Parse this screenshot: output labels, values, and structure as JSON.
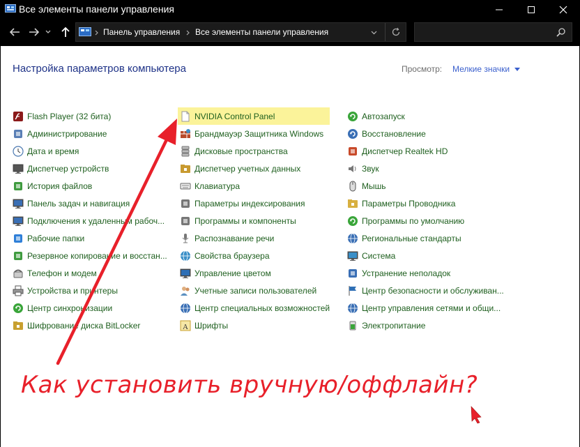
{
  "window": {
    "title": "Все элементы панели управления",
    "controls": {
      "minimize": "—",
      "maximize": "☐",
      "close": "✕"
    }
  },
  "toolbar": {
    "back_icon": "arrow-left-icon",
    "forward_icon": "arrow-right-icon",
    "up_icon": "arrow-up-icon",
    "breadcrumb": [
      "Панель управления",
      "Все элементы панели управления"
    ],
    "refresh_icon": "refresh-icon",
    "search_placeholder": ""
  },
  "main": {
    "heading": "Настройка параметров компьютера",
    "view_label": "Просмотр:",
    "view_value": "Мелкие значки"
  },
  "columns": [
    [
      {
        "label": "Flash Player (32 бита)",
        "icon": "flash-icon",
        "color": "#8b1a1a"
      },
      {
        "label": "Администрирование",
        "icon": "admin-tools-icon",
        "color": "#5a7fb5"
      },
      {
        "label": "Дата и время",
        "icon": "clock-icon",
        "color": "#4a78b0"
      },
      {
        "label": "Диспетчер устройств",
        "icon": "device-manager-icon",
        "color": "#555"
      },
      {
        "label": "История файлов",
        "icon": "file-history-icon",
        "color": "#3f9b3f"
      },
      {
        "label": "Панель задач и навигация",
        "icon": "taskbar-icon",
        "color": "#3a6fb5"
      },
      {
        "label": "Подключения к удаленным рабоч...",
        "icon": "remote-desktop-icon",
        "color": "#3a6fb5"
      },
      {
        "label": "Рабочие папки",
        "icon": "work-folders-icon",
        "color": "#2f7fd8"
      },
      {
        "label": "Резервное копирование и восстан...",
        "icon": "backup-icon",
        "color": "#3f9b3f"
      },
      {
        "label": "Телефон и модем",
        "icon": "phone-icon",
        "color": "#666"
      },
      {
        "label": "Устройства и принтеры",
        "icon": "printer-icon",
        "color": "#555"
      },
      {
        "label": "Центр синхронизации",
        "icon": "sync-icon",
        "color": "#3aa53a"
      },
      {
        "label": "Шифрование диска BitLocker",
        "icon": "bitlocker-icon",
        "color": "#c8a030"
      }
    ],
    [
      {
        "label": "NVIDIA Control Panel",
        "icon": "document-icon",
        "color": "#999",
        "highlight": true
      },
      {
        "label": "Брандмауэр Защитника Windows",
        "icon": "firewall-icon",
        "color": "#b84a2a"
      },
      {
        "label": "Дисковые пространства",
        "icon": "storage-spaces-icon",
        "color": "#777"
      },
      {
        "label": "Диспетчер учетных данных",
        "icon": "credential-manager-icon",
        "color": "#c89a30"
      },
      {
        "label": "Клавиатура",
        "icon": "keyboard-icon",
        "color": "#666"
      },
      {
        "label": "Параметры индексирования",
        "icon": "indexing-icon",
        "color": "#777"
      },
      {
        "label": "Программы и компоненты",
        "icon": "programs-icon",
        "color": "#777"
      },
      {
        "label": "Распознавание речи",
        "icon": "microphone-icon",
        "color": "#777"
      },
      {
        "label": "Свойства браузера",
        "icon": "internet-options-icon",
        "color": "#3a8fc8"
      },
      {
        "label": "Управление цветом",
        "icon": "color-management-icon",
        "color": "#2f6fb5"
      },
      {
        "label": "Учетные записи пользователей",
        "icon": "user-accounts-icon",
        "color": "#5a8fc0"
      },
      {
        "label": "Центр специальных возможностей",
        "icon": "accessibility-icon",
        "color": "#3a6fb5"
      },
      {
        "label": "Шрифты",
        "icon": "fonts-icon",
        "color": "#c8a030"
      }
    ],
    [
      {
        "label": "Автозапуск",
        "icon": "autoplay-icon",
        "color": "#3aa53a"
      },
      {
        "label": "Восстановление",
        "icon": "recovery-icon",
        "color": "#3a6fb5"
      },
      {
        "label": "Диспетчер Realtek HD",
        "icon": "realtek-audio-icon",
        "color": "#c84a2a"
      },
      {
        "label": "Звук",
        "icon": "speaker-icon",
        "color": "#777"
      },
      {
        "label": "Мышь",
        "icon": "mouse-icon",
        "color": "#555"
      },
      {
        "label": "Параметры Проводника",
        "icon": "folder-options-icon",
        "color": "#d8b040"
      },
      {
        "label": "Программы по умолчанию",
        "icon": "default-programs-icon",
        "color": "#3aa53a"
      },
      {
        "label": "Региональные стандарты",
        "icon": "region-icon",
        "color": "#3a6fb5"
      },
      {
        "label": "Система",
        "icon": "system-icon",
        "color": "#3a8fc8"
      },
      {
        "label": "Устранение неполадок",
        "icon": "troubleshooting-icon",
        "color": "#3a6fb5"
      },
      {
        "label": "Центр безопасности и обслуживан...",
        "icon": "security-flag-icon",
        "color": "#2f6fb5"
      },
      {
        "label": "Центр управления сетями и общи...",
        "icon": "network-center-icon",
        "color": "#3a6fb5"
      },
      {
        "label": "Электропитание",
        "icon": "power-options-icon",
        "color": "#3aa53a"
      }
    ]
  ],
  "annotation": {
    "text": "Как установить вручную/оффлайн?",
    "color": "#e8202a"
  }
}
